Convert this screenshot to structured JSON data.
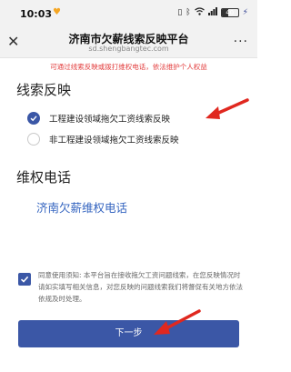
{
  "status_bar": {
    "time": "10:03",
    "battery": "40",
    "icons": [
      "heart-icon",
      "vibrate-icon",
      "bluetooth-icon",
      "wifi-icon",
      "cellular-icon",
      "battery-icon",
      "charging-icon"
    ]
  },
  "header": {
    "title": "济南市欠薪线索反映平台",
    "url": "sd.shengbangtec.com",
    "close_icon": "close-icon",
    "more_label": "..."
  },
  "notice": "可通过线索反映或拨打维权电话，依法维护个人权益",
  "clue_section": {
    "title": "线索反映",
    "options": [
      {
        "label": "工程建设领域拖欠工资线索反映",
        "checked": true
      },
      {
        "label": "非工程建设领域拖欠工资线索反映",
        "checked": false
      }
    ]
  },
  "phone_section": {
    "title": "维权电话",
    "link": "济南欠薪维权电话"
  },
  "consent": {
    "checked": true,
    "text": "同意使用须知: 本平台旨在接收拖欠工资问题线索，在您反映情况时请如实填写相关信息，对您反映的问题线索我们将督促有关地方依法依规及时处理。"
  },
  "next_button": "下一步",
  "colors": {
    "primary": "#3b57a6",
    "notice_red": "#e23b3b",
    "link_blue": "#3565c0",
    "arrow_red": "#e0281f"
  }
}
